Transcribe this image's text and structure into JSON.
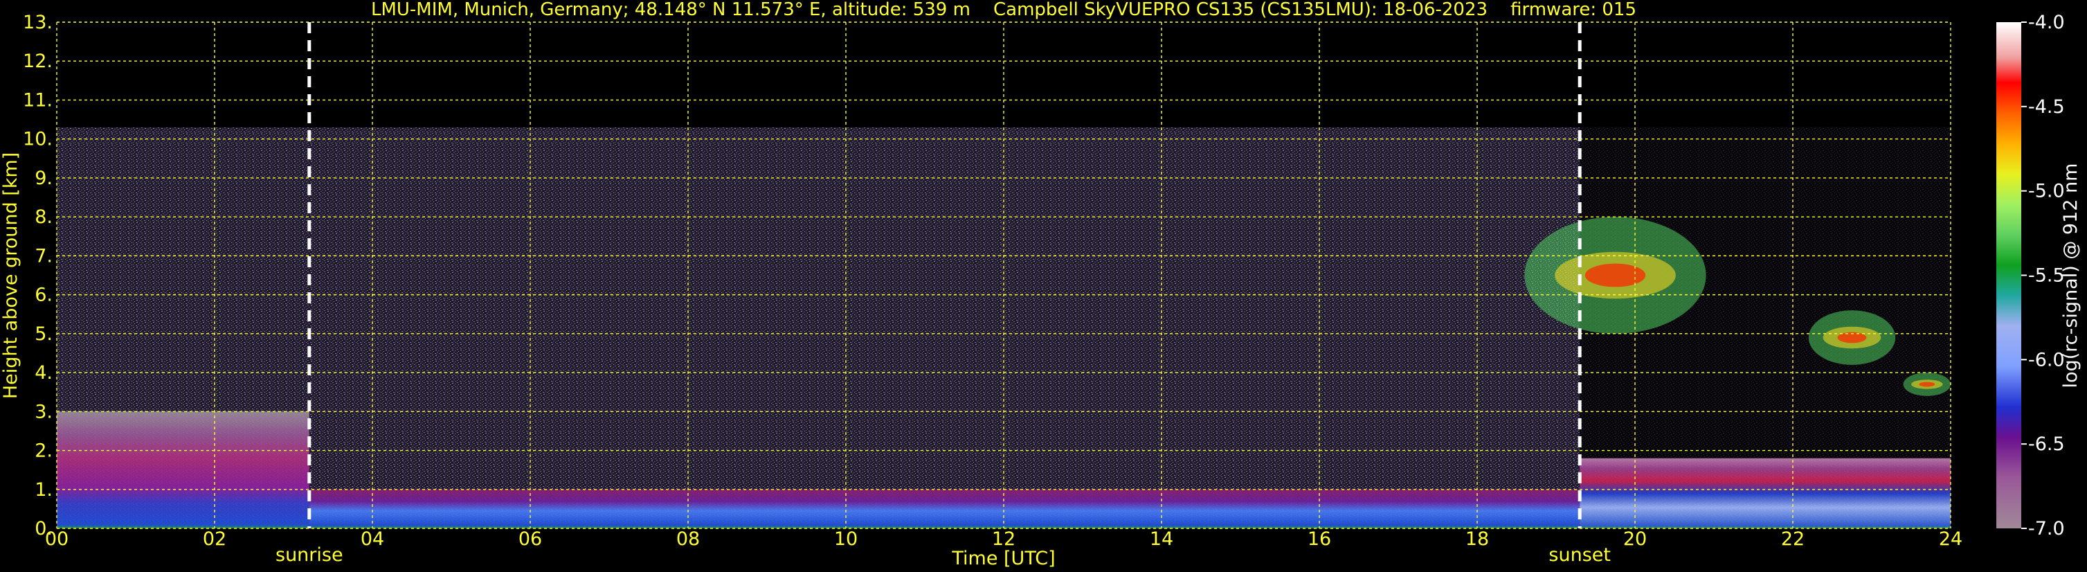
{
  "chart_data": {
    "type": "heatmap",
    "title": "LMU-MIM, Munich, Germany; 48.148° N 11.573° E, altitude: 539 m    Campbell SkyVUEPRO CS135 (CS135LMU): 18-06-2023    firmware: 015",
    "xlabel": "Time [UTC]",
    "ylabel": "Height above ground [km]",
    "xlim": [
      0,
      24
    ],
    "ylim": [
      0,
      13
    ],
    "x_ticks": [
      "00",
      "02",
      "04",
      "06",
      "08",
      "10",
      "12",
      "14",
      "16",
      "18",
      "20",
      "22",
      "24"
    ],
    "y_ticks": [
      "0.",
      "1.",
      "2.",
      "3.",
      "4.",
      "5.",
      "6.",
      "7.",
      "8.",
      "9.",
      "10.",
      "11.",
      "12.",
      "13."
    ],
    "grid": true,
    "colorbar": {
      "label": "log(rc-signal) @ 912 nm",
      "range": [
        -7.0,
        -4.0
      ],
      "ticks": [
        "-4.0",
        "-4.5",
        "-5.0",
        "-5.5",
        "-6.0",
        "-6.5",
        "-7.0"
      ]
    },
    "events": [
      {
        "label": "sunrise",
        "time_utc": 3.2
      },
      {
        "label": "sunset",
        "time_utc": 19.3
      }
    ],
    "features": [
      {
        "type": "boundary layer aerosol",
        "t_start": 0,
        "t_end": 3.2,
        "z_top_km": 3.0
      },
      {
        "type": "boundary layer aerosol",
        "t_start": 3.2,
        "t_end": 19.3,
        "z_top_km": 1.0
      },
      {
        "type": "residual layer",
        "t_start": 19.3,
        "t_end": 24,
        "z_top_km": 1.8
      },
      {
        "type": "cloud",
        "t_start": 18.6,
        "t_end": 20.9,
        "z_bottom_km": 5.0,
        "z_top_km": 8.0
      },
      {
        "type": "cloud",
        "t_start": 22.2,
        "t_end": 23.3,
        "z_bottom_km": 4.2,
        "z_top_km": 5.6
      },
      {
        "type": "cloud",
        "t_start": 23.4,
        "t_end": 24,
        "z_bottom_km": 3.4,
        "z_top_km": 4.0
      }
    ]
  }
}
